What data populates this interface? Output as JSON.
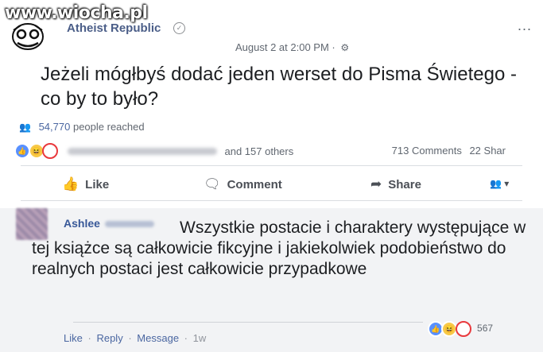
{
  "watermark": "www.wiocha.pl",
  "post": {
    "page_name": "Atheist Republic",
    "verified_icon": "check-circle-icon",
    "more_label": "...",
    "timestamp": "August 2 at 2:00 PM",
    "separator": "·",
    "audience_icon": "gear-icon",
    "text": "Jeżeli mógłbyś dodać jeden werset do Pisma Świetego - co by to było?",
    "reach": {
      "count": "54,770",
      "label": "people reached"
    },
    "reactions": {
      "others": "and 157 others",
      "comments": "713 Comments",
      "shares": "22 Shar"
    },
    "actions": {
      "like": "Like",
      "comment": "Comment",
      "share": "Share"
    }
  },
  "comment": {
    "author_first": "Ashlee",
    "text": "Wszystkie postacie i charaktery występujące w tej książce są całkowicie fikcyjne i jakiekolwiek podobieństwo do realnych postaci jest całkowicie przypadkowe",
    "reaction_count": "567",
    "actions": {
      "like": "Like",
      "reply": "Reply",
      "message": "Message",
      "time": "1w"
    }
  },
  "colors": {
    "link_blue": "#385898",
    "meta_gray": "#606770",
    "like_blue": "#5890ff"
  }
}
